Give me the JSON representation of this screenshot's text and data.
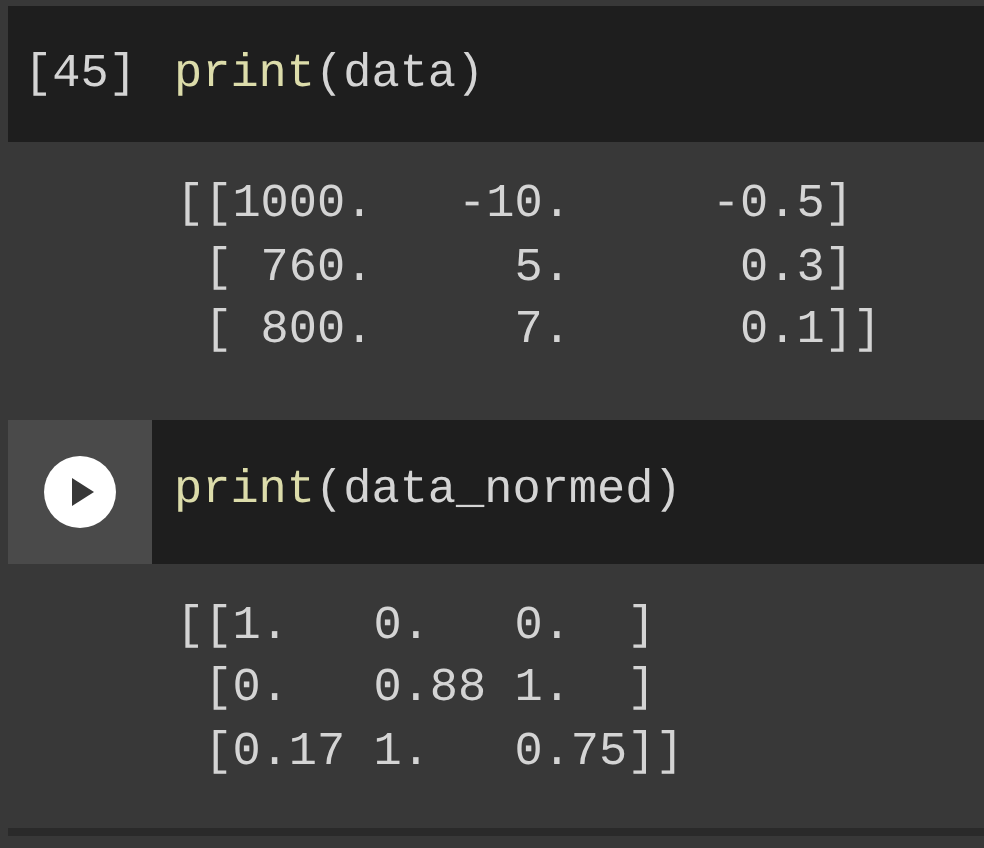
{
  "cells": [
    {
      "kind": "executed",
      "prompt": "[45]",
      "code": {
        "function": "print",
        "rest": "(data)"
      },
      "output": [
        "[[1000.   -10.     -0.5]",
        " [ 760.     5.      0.3]",
        " [ 800.     7.      0.1]]"
      ]
    },
    {
      "kind": "runnable",
      "code": {
        "function": "print",
        "rest": "(data_normed)"
      },
      "output": [
        "[[1.   0.   0.  ]",
        " [0.   0.88 1.  ]",
        " [0.17 1.   0.75]]"
      ]
    }
  ]
}
